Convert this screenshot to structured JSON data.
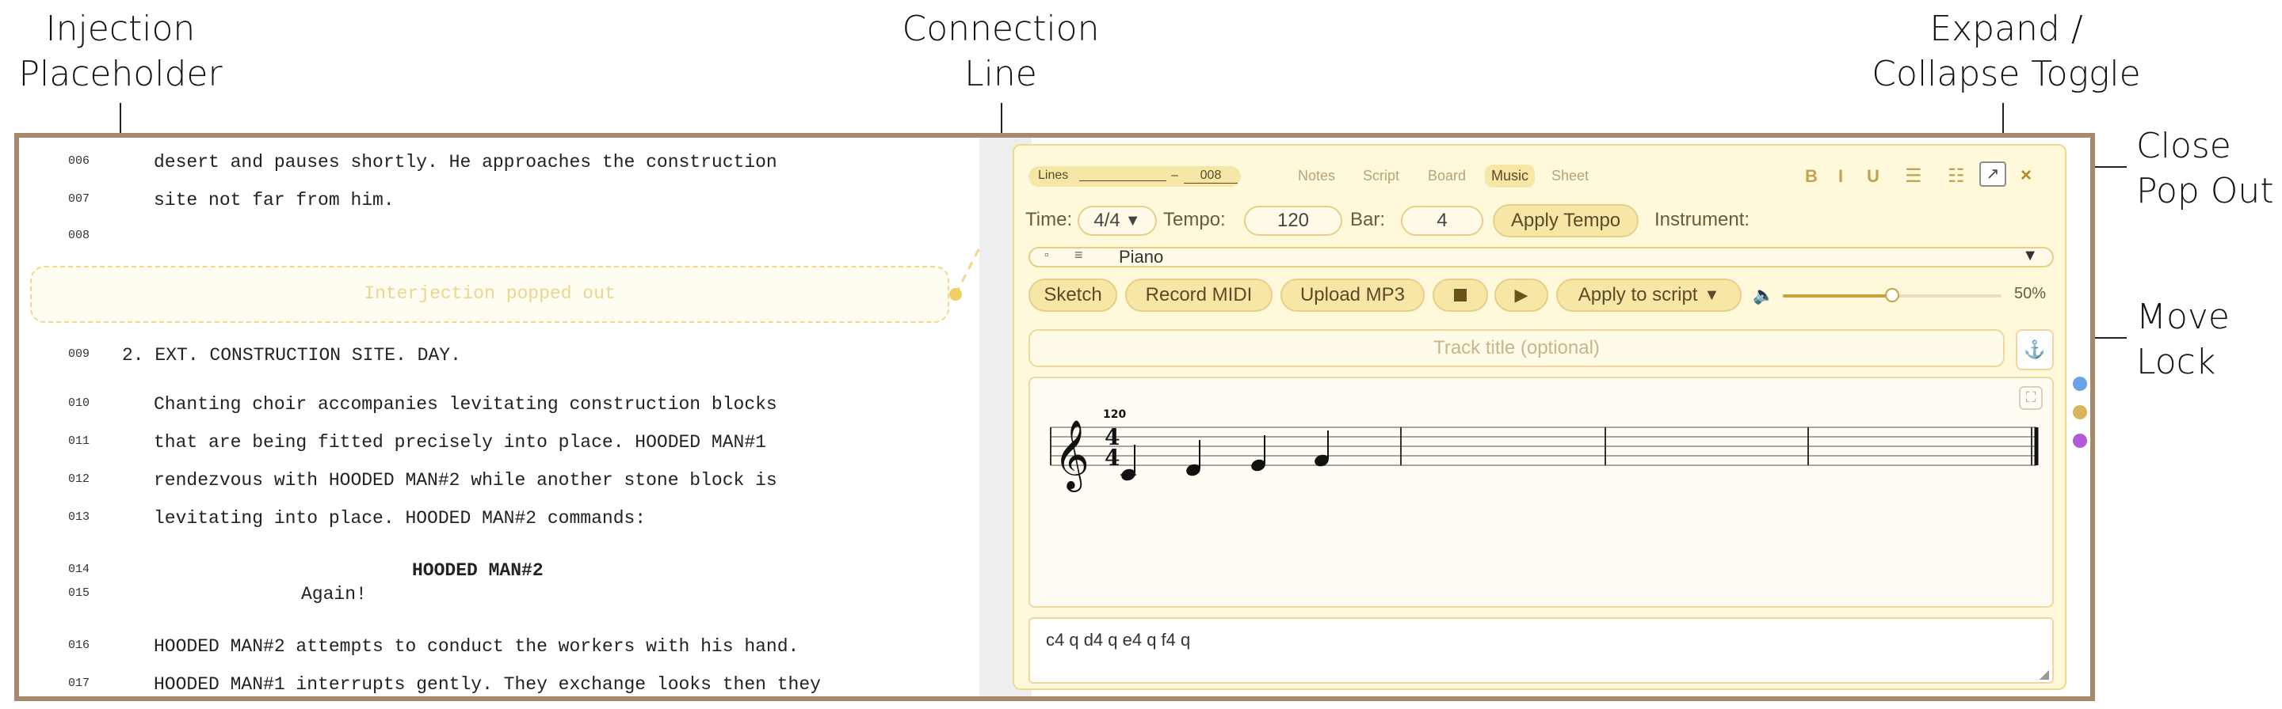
{
  "callouts": {
    "injection": [
      "Injection",
      "Placeholder"
    ],
    "connection": [
      "Connection",
      "Line"
    ],
    "expand": [
      "Expand /",
      "Collapse Toggle"
    ],
    "close": [
      "Close",
      "Pop Out"
    ],
    "move_lock": [
      "Move",
      "Lock"
    ]
  },
  "script": {
    "lines": [
      {
        "num": "006",
        "text": "desert and pauses shortly. He approaches the construction"
      },
      {
        "num": "007",
        "text": "site not far from him."
      },
      {
        "num": "008",
        "text": ""
      },
      {
        "num": "009",
        "text": "2. EXT. CONSTRUCTION SITE. DAY."
      },
      {
        "num": "010",
        "text": "Chanting choir accompanies levitating construction blocks"
      },
      {
        "num": "011",
        "text": "that are being fitted precisely into place. HOODED MAN#1"
      },
      {
        "num": "012",
        "text": "rendezvous with HOODED MAN#2 while another stone block is"
      },
      {
        "num": "013",
        "text": "levitating into place. HOODED MAN#2 commands:"
      },
      {
        "num": "014",
        "text": "HOODED MAN#2"
      },
      {
        "num": "015",
        "text": "Again!"
      },
      {
        "num": "016",
        "text": "HOODED MAN#2 attempts to conduct the workers with his hand."
      },
      {
        "num": "017",
        "text": "HOODED MAN#1 interrupts gently. They exchange looks then they"
      }
    ],
    "placeholder": "Interjection popped out"
  },
  "popout": {
    "lines_label": "Lines",
    "lines_from": "",
    "lines_to": "008",
    "tabs": [
      "Notes",
      "Script",
      "Board",
      "Music",
      "Sheet"
    ],
    "active_tab": "Music",
    "format_buttons": [
      "B",
      "I",
      "U"
    ],
    "time_label": "Time:",
    "time_value": "4/4",
    "tempo_label": "Tempo:",
    "tempo_value": "120",
    "bar_label": "Bar:",
    "bar_value": "4",
    "apply_tempo": "Apply Tempo",
    "instrument_label": "Instrument:",
    "instrument_value": "Piano",
    "buttons": {
      "sketch": "Sketch",
      "record_midi": "Record MIDI",
      "upload_mp3": "Upload MP3",
      "apply_to_script": "Apply to script"
    },
    "volume_level": 0.5,
    "volume_text": "50%",
    "track_title_placeholder": "Track title (optional)",
    "tempo_marking": "120",
    "notes_text": "c4 q d4 q e4 q f4 q",
    "colors": {
      "accent": "#f7e7a7",
      "border": "#e8cf86",
      "frame": "#a6896a"
    }
  }
}
